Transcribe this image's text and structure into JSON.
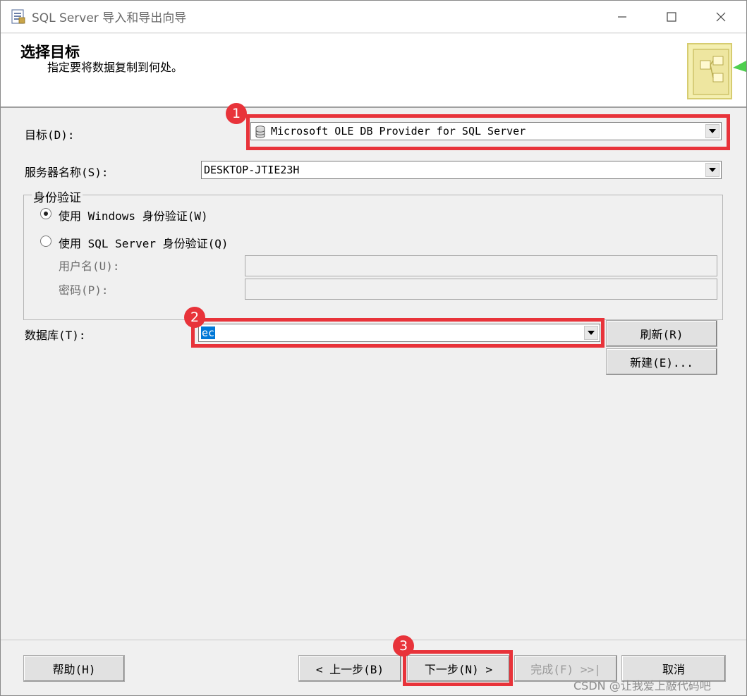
{
  "window": {
    "title": "SQL Server 导入和导出向导",
    "min_icon": "minimize-icon",
    "max_icon": "maximize-icon",
    "close_icon": "close-icon"
  },
  "header": {
    "title": "选择目标",
    "subtitle": "指定要将数据复制到何处。"
  },
  "form": {
    "destination_label": "目标(D):",
    "destination_value": "Microsoft OLE DB Provider for SQL Server",
    "server_label": "服务器名称(S):",
    "server_value": "DESKTOP-JTIE23H",
    "auth_group": "身份验证",
    "auth_windows": "使用 Windows 身份验证(W)",
    "auth_sql": "使用 SQL Server 身份验证(Q)",
    "auth_selected": "windows",
    "username_label": "用户名(U):",
    "password_label": "密码(P):",
    "database_label": "数据库(T):",
    "database_value": "ec",
    "refresh_button": "刷新(R)",
    "new_button": "新建(E)..."
  },
  "footer": {
    "help": "帮助(H)",
    "back": "< 上一步(B)",
    "next": "下一步(N) >",
    "finish": "完成(F) >>|",
    "cancel": "取消"
  },
  "annotations": {
    "badge1": "1",
    "badge2": "2",
    "badge3": "3",
    "color": "#e8333a"
  },
  "watermark": "CSDN @让我爱上敲代码吧"
}
